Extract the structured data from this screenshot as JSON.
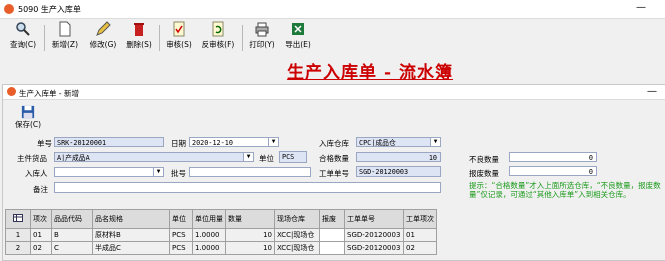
{
  "window": {
    "title": "5090 生产入库单"
  },
  "toolbar": [
    {
      "label": "查询(C)",
      "icon": "search-icon"
    },
    {
      "label": "新增(Z)",
      "icon": "new-document-icon"
    },
    {
      "label": "修改(G)",
      "icon": "edit-icon"
    },
    {
      "label": "删除(S)",
      "icon": "trash-icon"
    },
    {
      "label": "审核(S)",
      "icon": "approve-icon"
    },
    {
      "label": "反审核(F)",
      "icon": "unapprove-icon"
    },
    {
      "label": "打印(Y)",
      "icon": "printer-icon"
    },
    {
      "label": "导出(E)",
      "icon": "excel-icon"
    }
  ],
  "page_title": "生产入库单 - 流水簿",
  "subwindow": {
    "title": "生产入库单 - 新增",
    "save_label": "保存(C)"
  },
  "form": {
    "doc_no_label": "单号",
    "doc_no": "SRK-20120001",
    "date_label": "日期",
    "date": "2020-12-10",
    "warehouse_label": "入库仓库",
    "warehouse": "CPC|成品仓",
    "main_product_label": "主件货品",
    "main_product": "A|产成品A",
    "unit_label": "单位",
    "unit": "PCS",
    "qualified_qty_label": "合格数量",
    "qualified_qty": "10",
    "receiver_label": "入库人",
    "receiver": "",
    "batch_label": "批号",
    "batch": "",
    "work_order_label": "工单单号",
    "work_order": "SGD-20120003",
    "defect_qty_label": "不良数量",
    "defect_qty": "0",
    "scrap_qty_label": "报废数量",
    "scrap_qty": "0",
    "remark_label": "备注",
    "remark": ""
  },
  "hint": "提示：“合格数量”才入上面所选仓库，“不良数量，报废数量”仅记录，可通过“其他入库单”入到相关仓库。",
  "table": {
    "headers": [
      "项次",
      "品品代码",
      "品名规格",
      "单位",
      "单位用量",
      "数量",
      "现场仓库",
      "报废",
      "工单单号",
      "工单项次"
    ],
    "rows": [
      [
        "1",
        "01",
        "B",
        "原材料B",
        "PCS",
        "1.0000",
        "10",
        "XCC|现场仓",
        "",
        "SGD-20120003",
        "01"
      ],
      [
        "2",
        "02",
        "C",
        "半成品C",
        "PCS",
        "1.0000",
        "10",
        "XCC|现场仓",
        "",
        "SGD-20120003",
        "02"
      ]
    ]
  }
}
